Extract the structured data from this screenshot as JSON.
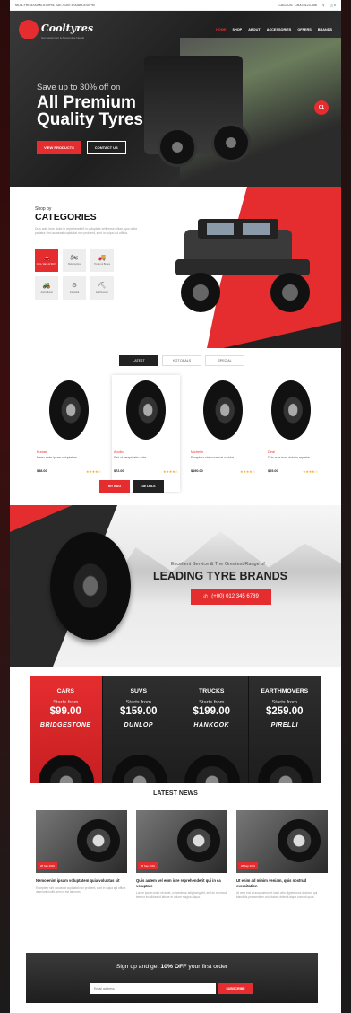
{
  "topbar": {
    "hours": "MON-FRI: 8:00AM-5:00PM, SAT-SUN: 8:00AM-5:00PM",
    "call": "CALL US: 1-800-0123-456",
    "search_icon": "search-icon",
    "cart_icon": "cart-icon",
    "cart_count": "0"
  },
  "nav": {
    "logo": "Cooltyres",
    "logo_tagline": "Get Equipment & Automotive Needs",
    "menu": [
      "HOME",
      "SHOP",
      "ABOUT",
      "ACCESSORIES",
      "OFFERS",
      "BRANDS"
    ]
  },
  "hero": {
    "subtitle": "Save up to 30% off on",
    "title": "All Premium Quality Tyres",
    "btn_primary": "VIEW PRODUCTS",
    "btn_secondary": "CONTACT US",
    "slide": "01"
  },
  "categories": {
    "eyebrow": "Shop by",
    "title": "CATEGORIES",
    "desc": "Duis aute irure dolor in reprehenderit in voluptate velit esse cillum, quo nulla pariatur sint occaecat cupidatat non proident, sunt in culpa qui officia.",
    "items": [
      {
        "label": "Cars, Vans & SUVs",
        "icon": "car-icon"
      },
      {
        "label": "Motorcycles",
        "icon": "motorcycle-icon"
      },
      {
        "label": "Trucks & Buses",
        "icon": "truck-icon"
      },
      {
        "label": "Agricultural",
        "icon": "tractor-icon"
      },
      {
        "label": "Industrial",
        "icon": "forklift-icon"
      },
      {
        "label": "Earthmover",
        "icon": "earthmover-icon"
      }
    ]
  },
  "products": {
    "tabs": [
      "LATEST",
      "HOT DEALS",
      "SPECIAL"
    ],
    "items": [
      {
        "brand": "Kumar",
        "name": "Nemo enim ipsam voluptatem",
        "price": "$58.00",
        "stars": "★★★★☆"
      },
      {
        "brand": "Apollo",
        "name": "Sed ut perspiciatis unde",
        "price": "$72.00",
        "stars": "★★★★☆"
      },
      {
        "brand": "Michelin",
        "name": "Excepteur sint occaecat cupidat",
        "price": "$190.00",
        "stars": "★★★★☆"
      },
      {
        "brand": "Deal",
        "name": "Duis aute irure dolor in reprehe",
        "price": "$69.00",
        "stars": "★★★★☆"
      }
    ],
    "btn_bag": "MY BAG",
    "btn_details": "DETAILS"
  },
  "brands": {
    "subtitle": "Excellent Service & The Greatest Range of",
    "title": "LEADING TYRE BRANDS",
    "phone": "(+00) 012 345 6789"
  },
  "pricing": [
    {
      "title": "CARS",
      "starts": "Starts from",
      "price": "$99.00",
      "brand": "BRIDGESTONE"
    },
    {
      "title": "SUVS",
      "starts": "Starts from",
      "price": "$159.00",
      "brand": "DUNLOP"
    },
    {
      "title": "TRUCKS",
      "starts": "Starts from",
      "price": "$199.00",
      "brand": "HANKOOK"
    },
    {
      "title": "EARTHMOVERS",
      "starts": "Starts from",
      "price": "$259.00",
      "brand": "PIRELLI"
    }
  ],
  "news": {
    "title": "LATEST NEWS",
    "items": [
      {
        "date": "28 Sep 2019",
        "headline": "Nemo enim ipsam voluptatem quia voluptas sit",
        "text": "Excepteur sint occaecat cupidatat non proident, sunt in culpa qui officia deserunt mollit anim id est laborum."
      },
      {
        "date": "28 Sep 2019",
        "headline": "Quis autem vel eum iure reprehenderit qui in ea voluptate",
        "text": "Lorem ipsum dolor sit amet, consectetur adipiscing elit, sed do eiusmod tempor incididunt ut labore et dolore magna aliqua."
      },
      {
        "date": "28 Sep 2019",
        "headline": "Ut enim ad minim veniam, quis nostrud exercitation",
        "text": "At vero eos et accusamus et iusto odio dignissimos ducimus qui blanditiis praesentium voluptatum deleniti atque corrupti quos."
      }
    ]
  },
  "newsletter": {
    "text_before": "Sign up and get",
    "text_bold": "10% OFF",
    "text_after": "your first order",
    "placeholder": "Email address",
    "button": "SUBSCRIBE"
  },
  "colors": {
    "accent": "#e52d2f",
    "dark": "#222222"
  }
}
